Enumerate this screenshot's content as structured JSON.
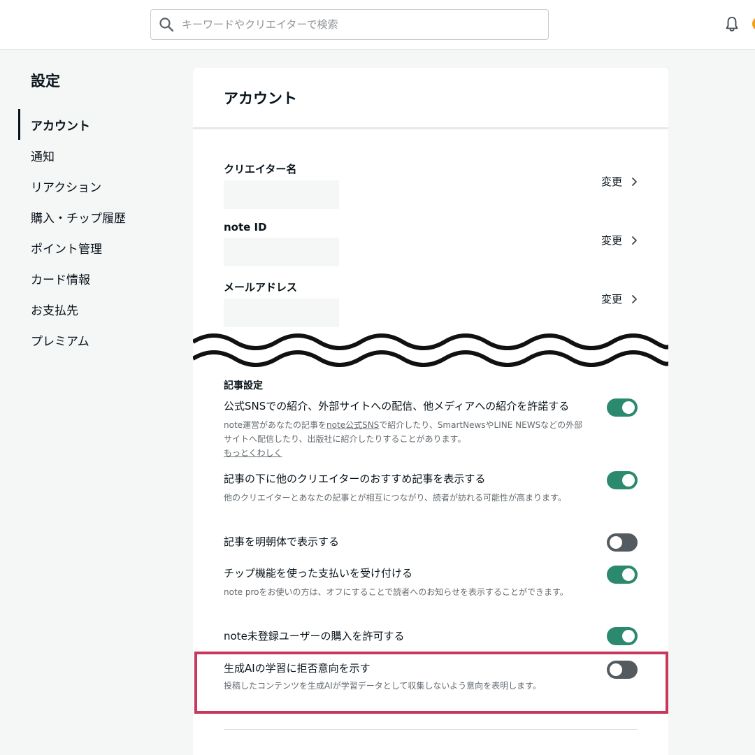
{
  "header": {
    "search_placeholder": "キーワードやクリエイターで検索",
    "search_value": ""
  },
  "sidebar": {
    "title": "設定",
    "items": [
      {
        "label": "アカウント",
        "active": true
      },
      {
        "label": "通知"
      },
      {
        "label": "リアクション"
      },
      {
        "label": "購入・チップ履歴"
      },
      {
        "label": "ポイント管理"
      },
      {
        "label": "カード情報"
      },
      {
        "label": "お支払先"
      },
      {
        "label": "プレミアム"
      }
    ]
  },
  "account": {
    "title": "アカウント",
    "change_label": "変更",
    "fields": [
      {
        "label": "クリエイター名",
        "value": ""
      },
      {
        "label": "note ID",
        "value": ""
      },
      {
        "label": "メールアドレス",
        "value": ""
      }
    ]
  },
  "article_settings": {
    "heading": "記事設定",
    "items": [
      {
        "title": "公式SNSでの紹介、外部サイトへの配信、他メディアへの紹介を許諾する",
        "desc_before": "note運営があなたの記事を",
        "desc_link": "note公式SNS",
        "desc_after": "で紹介したり、SmartNewsやLINE NEWSなどの外部サイトへ配信したり、出版社に紹介したりすることがあります。",
        "more_link": "もっとくわしく",
        "enabled": true
      },
      {
        "title": "記事の下に他のクリエイターのおすすめ記事を表示する",
        "desc": "他のクリエイターとあなたの記事とが相互につながり、読者が訪れる可能性が高まります。",
        "enabled": true
      },
      {
        "title": "記事を明朝体で表示する",
        "enabled": false
      },
      {
        "title": "チップ機能を使った支払いを受け付ける",
        "desc": "note proをお使いの方は、オフにすることで読者へのお知らせを表示することができます。",
        "enabled": true
      },
      {
        "title": "note未登録ユーザーの購入を許可する",
        "enabled": true
      },
      {
        "title": "生成AIの学習に拒否意向を示す",
        "desc": "投稿したコンテンツを生成AIが学習データとして収集しないよう意向を表明します。",
        "enabled": false
      }
    ]
  },
  "colors": {
    "toggle_on": "#2b8a6e",
    "toggle_off": "#535a60",
    "highlight_border": "#c8385d"
  }
}
